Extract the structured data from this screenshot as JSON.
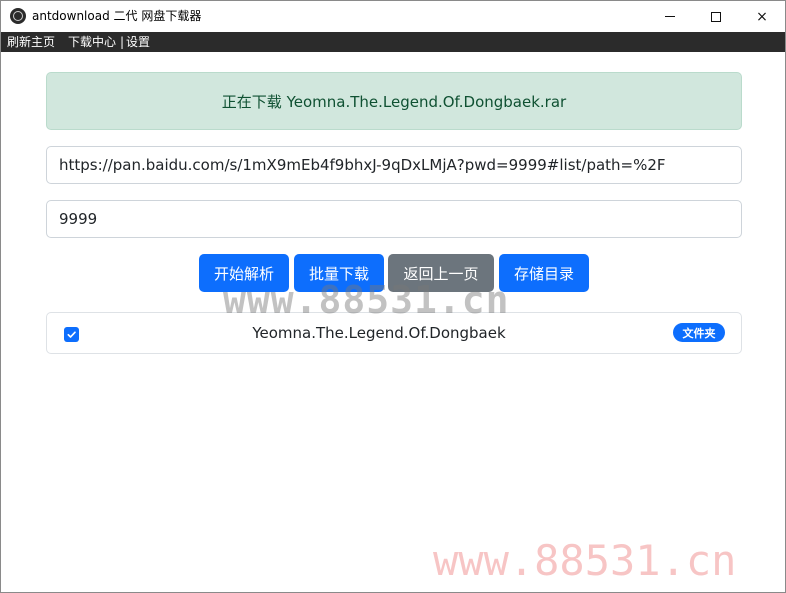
{
  "window": {
    "title": "antdownload 二代 网盘下载器",
    "app_icon": "antdownload-logo-icon",
    "controls": {
      "minimize": "minimize-icon",
      "maximize": "maximize-icon",
      "close": "×"
    }
  },
  "menu": {
    "items": [
      "刷新主页",
      "下载中心",
      "设置"
    ],
    "separator": "|"
  },
  "status": {
    "message": "正在下载 Yeomna.The.Legend.Of.Dongbaek.rar"
  },
  "form": {
    "url_value": "https://pan.baidu.com/s/1mX9mEb4f9bhxJ-9qDxLMjA?pwd=9999#list/path=%2F",
    "password_value": "9999"
  },
  "actions": {
    "parse": "开始解析",
    "batch_download": "批量下载",
    "back": "返回上一页",
    "storage_dir": "存储目录"
  },
  "file_list": [
    {
      "name": "Yeomna.The.Legend.Of.Dongbaek",
      "checked": true,
      "type_badge": "文件夹"
    }
  ],
  "watermarks": [
    "www.88531.cn",
    "www.88531.cn"
  ],
  "colors": {
    "primary": "#0d6efd",
    "secondary": "#6c757d",
    "success_bg": "#d1e7dd",
    "success_text": "#0f5132",
    "menubar_bg": "#2b2b2b"
  }
}
